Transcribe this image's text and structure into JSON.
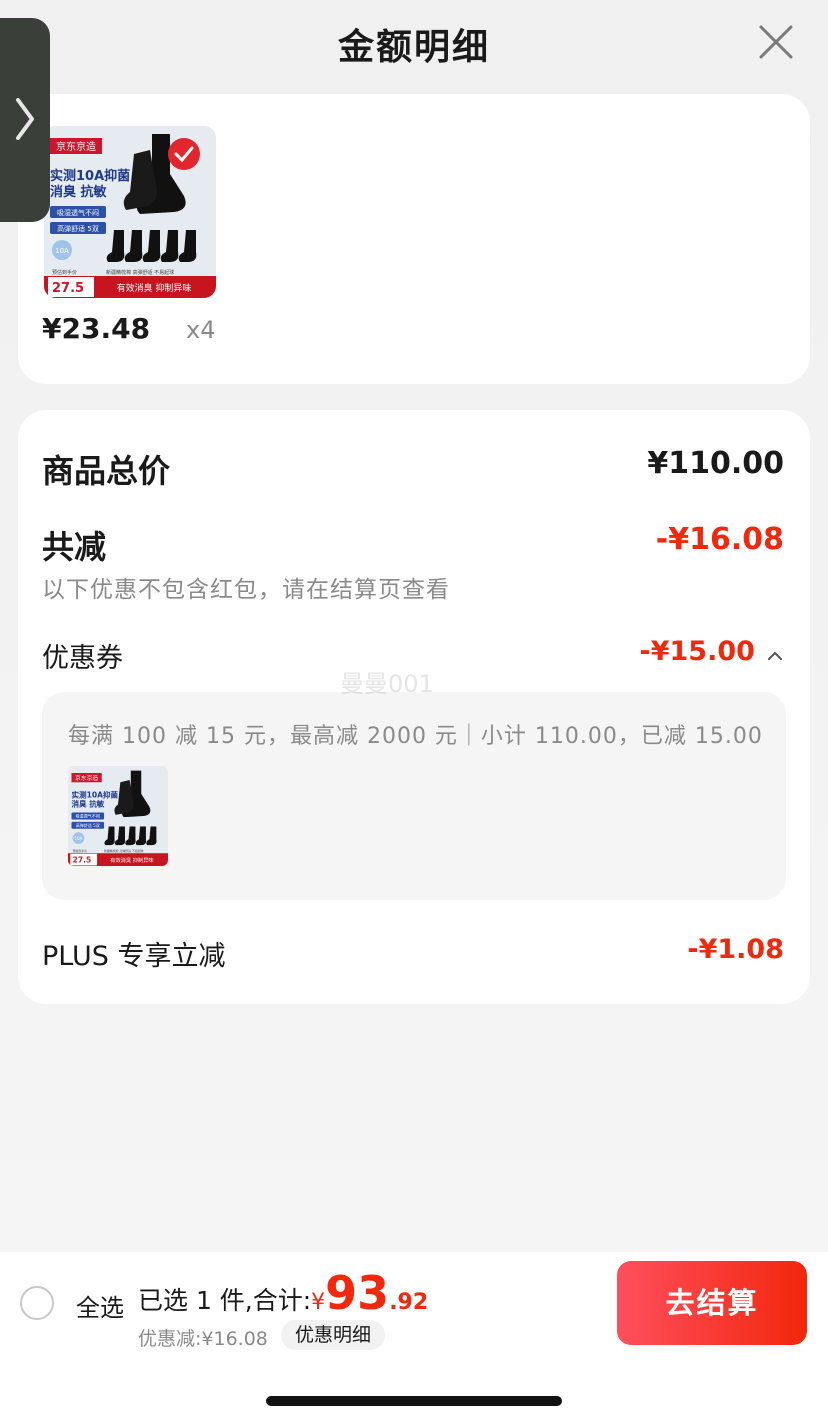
{
  "header": {
    "title": "金额明细",
    "close_icon": "close-icon",
    "side_handle_icon": "chevron-right-icon"
  },
  "product": {
    "image": {
      "brand_tag": "京东京造",
      "headline_line1": "实测10A抑菌",
      "headline_line2": "消臭 抗敏",
      "feature1": "吸湿透气不闷",
      "feature2": "高弹舒适 5双",
      "badge": "10A",
      "price_caption": "预估到手价",
      "price_tag": "27.5",
      "feature_line": "新疆精梳棉 高弹舒适 不易起球",
      "banner": "有效消臭 抑制异味"
    },
    "price_int": "¥23",
    "price_dec": ".48",
    "quantity": "x4"
  },
  "summary": {
    "total_label": "商品总价",
    "total_value": "¥110.00",
    "reduce_label": "共减",
    "reduce_value": "-¥16.08",
    "reduce_note": "以下优惠不包含红包，请在结算页查看",
    "coupon_label": "优惠券",
    "coupon_value": "-¥15.00",
    "coupon_rule": "每满 100 减 15 元，最高减 2000 元｜小计 110.00，已减 15.00",
    "plus_label": "PLUS 专享立减",
    "plus_value": "-¥1.08"
  },
  "watermark": "曼曼001",
  "bottom_bar": {
    "select_all": "全选",
    "selected_label": "已选 1 件,合计:",
    "currency": "¥",
    "total_int": "93",
    "total_dec": ".92",
    "discount": "优惠减:¥16.08",
    "discount_detail": "优惠明细",
    "checkout": "去结算"
  },
  "colors": {
    "accent_red": "#f2270c",
    "checkout_gradient_start": "#ff4f5e"
  }
}
